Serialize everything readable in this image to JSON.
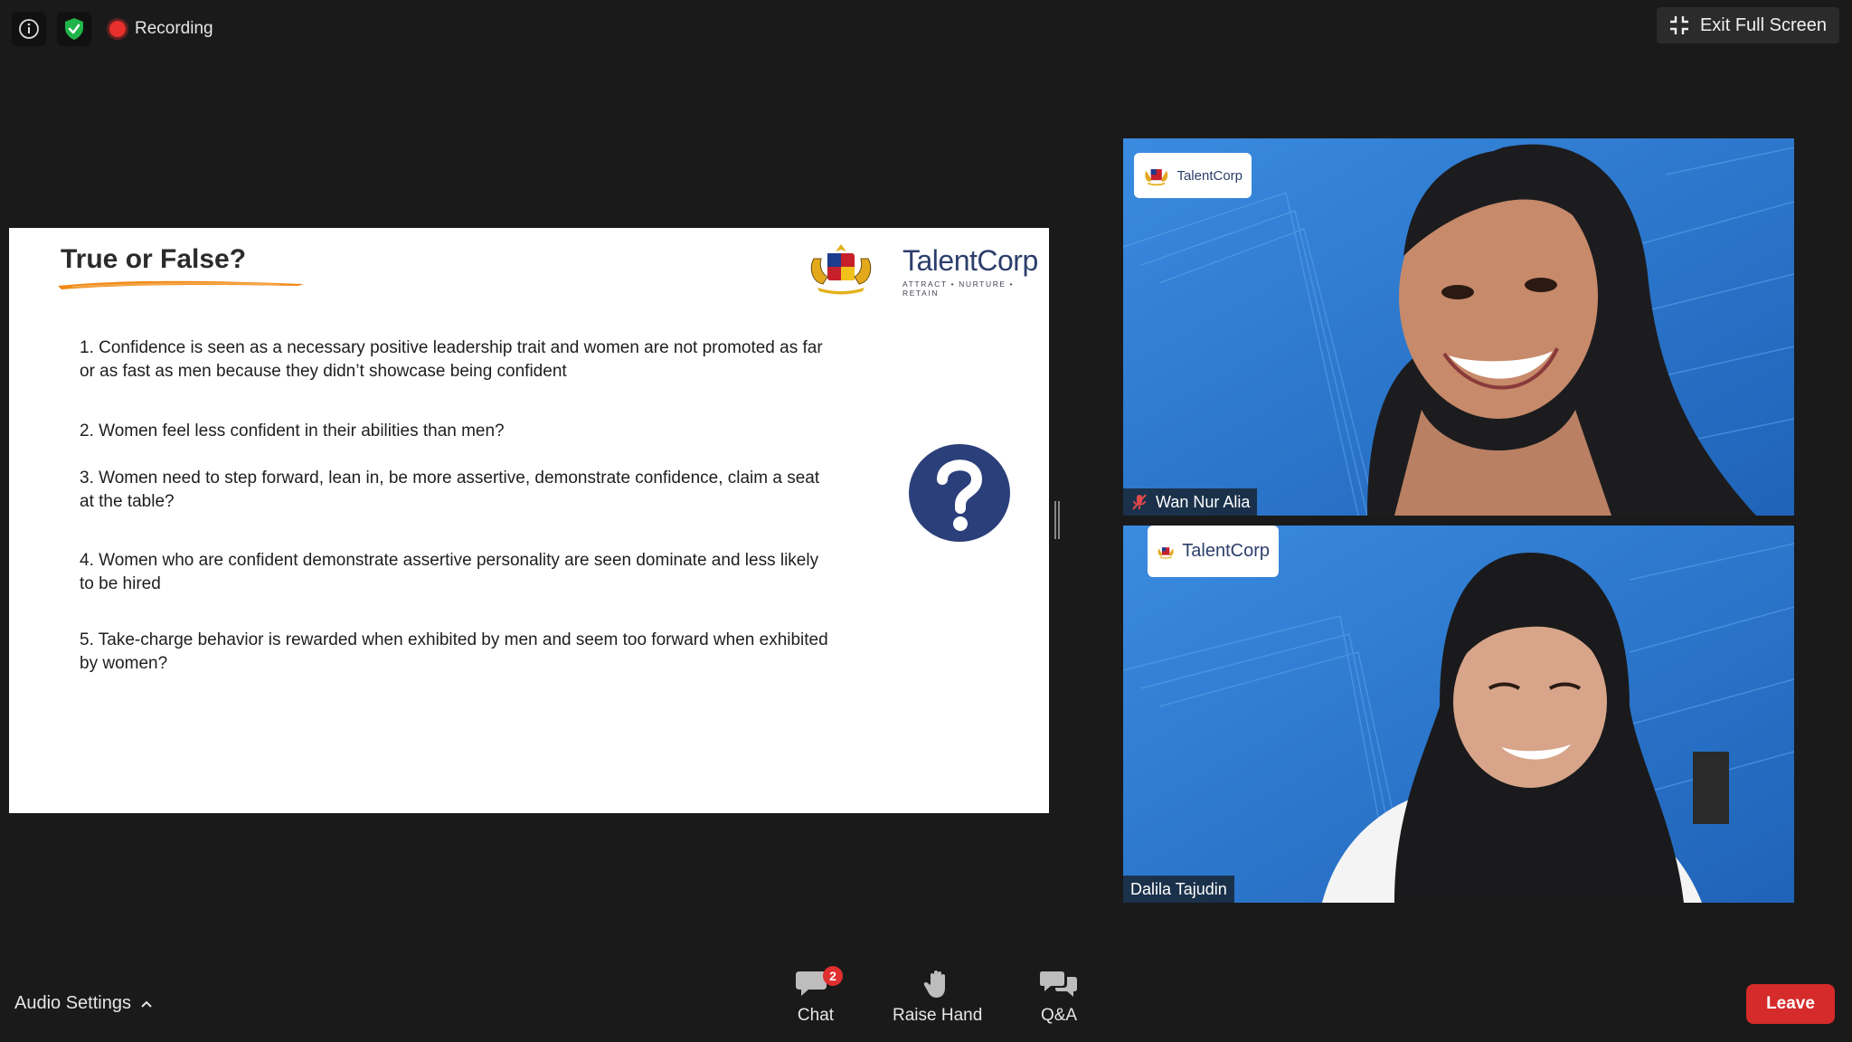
{
  "top_bar": {
    "recording_label": "Recording",
    "exit_fullscreen_label": "Exit Full Screen"
  },
  "slide": {
    "title": "True or False?",
    "logo_name": "TalentCorp",
    "logo_tagline": "ATTRACT • NURTURE • RETAIN",
    "questions": [
      {
        "line1": "1. Confidence is seen as a necessary positive leadership trait and women are not promoted as far",
        "line2": "or as fast as men because they didn’t showcase being confident"
      },
      {
        "line1": "2. Women feel less confident in their abilities than men?",
        "line2": ""
      },
      {
        "line1": "3. Women need to step forward, lean in, be more assertive, demonstrate confidence, claim a seat",
        "line2": "at the table?"
      },
      {
        "line1": "4. Women who are confident demonstrate assertive personality are seen dominate and less likely",
        "line2": "to be hired"
      },
      {
        "line1": "5. Take-charge behavior is rewarded when exhibited by men and seem too forward when exhibited",
        "line2": "by women?"
      }
    ]
  },
  "participants": [
    {
      "name": "Wan Nur Alia",
      "muted": true,
      "logo_name": "TalentCorp"
    },
    {
      "name": "Dalila Tajudin",
      "muted": false,
      "logo_name": "TalentCorp"
    }
  ],
  "bottom_bar": {
    "audio_settings_label": "Audio Settings",
    "chat_label": "Chat",
    "chat_badge": "2",
    "raise_hand_label": "Raise Hand",
    "qa_label": "Q&A",
    "leave_label": "Leave"
  },
  "colors": {
    "background": "#1a1a1a",
    "leave_button": "#d62b2b",
    "tile_background": "#2f7fd3",
    "brand_navy": "#2c3e6b",
    "question_icon": "#2b3f7a",
    "brush_stroke": "#f08a1a"
  }
}
